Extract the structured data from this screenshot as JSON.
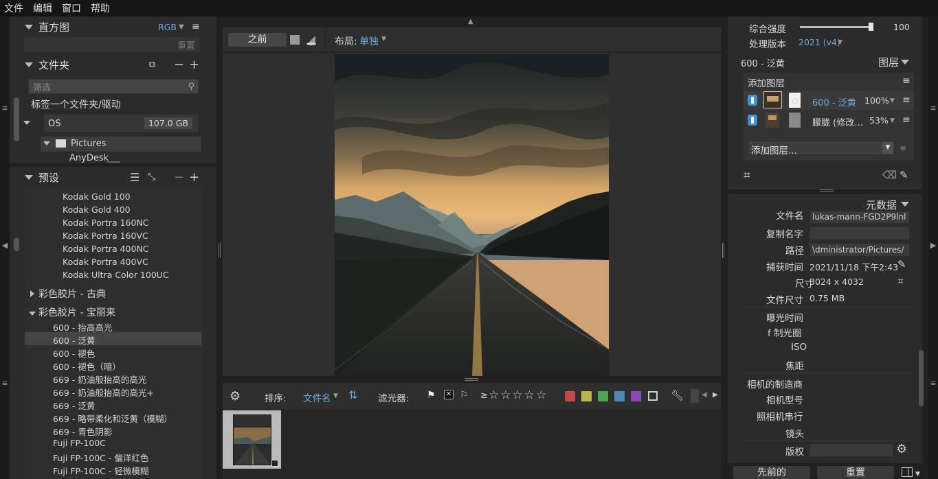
{
  "menu": [
    "文件",
    "编辑",
    "窗口",
    "帮助"
  ],
  "histogram": {
    "title": "直方图",
    "mode": "RGB",
    "reset": "重置"
  },
  "folders": {
    "title": "文件夹",
    "filter_placeholder": "筛选",
    "hint": "标签一个文件夹/驱动",
    "drive": {
      "name": "OS",
      "size": "107.0 GB"
    },
    "tree": [
      "Pictures",
      "AnyDesk"
    ]
  },
  "presets": {
    "title": "预设",
    "items": [
      "Kodak Gold 100",
      "Kodak Gold 400",
      "Kodak Portra 160NC",
      "Kodak Portra 160VC",
      "Kodak Portra 400NC",
      "Kodak Portra 400VC",
      "Kodak Ultra Color 100UC"
    ],
    "group_closed": "彩色胶片 - 古典",
    "group_open": "彩色胶片 - 宝丽来",
    "group_items": [
      "600 - 抬高高光",
      "600 - 泛黄",
      "600 - 褪色",
      "600 - 褪色（暗）",
      "669 - 奶油般抬高的高光",
      "669 - 奶油般抬高的高光+",
      "669 - 泛黄",
      "669 - 略带柔化和泛黄（模糊）",
      "669 - 青色阴影",
      "Fuji FP-100C",
      "Fuji FP-100C - 偏洋红色",
      "Fuji FP-100C - 轻微模糊"
    ],
    "selected_index": 1
  },
  "viewer": {
    "before_label": "之前",
    "layout_label": "布局:",
    "layout_value": "单独"
  },
  "filmbar": {
    "sort_label": "排序:",
    "sort_value": "文件名",
    "filter_label": "滤光器:",
    "rating_prefix": "≥",
    "color_labels": [
      "#c04a4a",
      "#b8b84a",
      "#4aa84a",
      "#4a88b8",
      "#8a4ab8"
    ]
  },
  "adjust": {
    "strength_label": "综合强度",
    "strength_value": "100",
    "strength_fraction": 1.0,
    "version_label": "处理版本",
    "version_value": "2021 (v4)"
  },
  "layers": {
    "style_name": "600 - 泛黄",
    "title": "图层",
    "add_layer": "添加图层",
    "rows": [
      {
        "name": "600 - 泛黄",
        "opacity": "100%"
      },
      {
        "name": "朦胧 (修改…",
        "opacity": "53%"
      }
    ],
    "add_dropdown": "添加图层..."
  },
  "metadata": {
    "title": "元数据",
    "filename_label": "文件名",
    "filename": "lukas-mann-FGD2P9lnl",
    "copyname_label": "复制名字",
    "path_label": "路径",
    "path": "\\dministrator/Pictures/",
    "captured_label": "捕获时间",
    "captured": "2021/11/18 下午2:43",
    "size_label": "尺寸",
    "size": "3024 x 4032",
    "filesize_label": "文件尺寸",
    "filesize": "0.75 MB",
    "exposure_label": "曝光时间",
    "aperture_label": "f 制光圈",
    "iso_label": "ISO",
    "focal_label": "焦距",
    "maker_label": "相机的制造商",
    "model_label": "相机型号",
    "serial_label": "照相机串行",
    "lens_label": "镜头",
    "copyright_label": "版权"
  },
  "bottom_buttons": {
    "previous": "先前的",
    "reset": "重置"
  }
}
